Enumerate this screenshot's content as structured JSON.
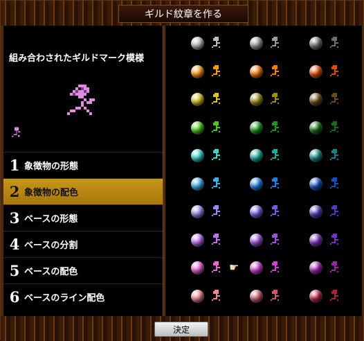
{
  "window": {
    "title": "ギルド紋章を作る"
  },
  "preview": {
    "label": "組み合わされたギルドマーク模様",
    "icon": "rose-mark-icon"
  },
  "menu": {
    "items": [
      {
        "num": "1",
        "label": "象徴物の形態",
        "selected": false
      },
      {
        "num": "2",
        "label": "象徴物の配色",
        "selected": true
      },
      {
        "num": "3",
        "label": "ベースの形態",
        "selected": false
      },
      {
        "num": "4",
        "label": "ベースの分割",
        "selected": false
      },
      {
        "num": "5",
        "label": "ベースの配色",
        "selected": false
      },
      {
        "num": "6",
        "label": "ベースのライン配色",
        "selected": false
      }
    ]
  },
  "palette": {
    "rows": [
      [
        "#bcbcbc",
        "#9a9a9a",
        "#6e6e6e"
      ],
      [
        "#ff9a10",
        "#ff7a00",
        "#e24a00"
      ],
      [
        "#d8c61e",
        "#9e8e10",
        "#6a4a10"
      ],
      [
        "#4acc1a",
        "#1a9a1a",
        "#107010"
      ],
      [
        "#3ad8c8",
        "#1ab0a0",
        "#108888"
      ],
      [
        "#3ab0f0",
        "#1a80e8",
        "#1050c8"
      ],
      [
        "#9a8af0",
        "#7060e0",
        "#5038c0"
      ],
      [
        "#c070f0",
        "#a050e0",
        "#7830c0"
      ],
      [
        "#f060d8",
        "#d040d8",
        "#a020b0"
      ],
      [
        "#f08890",
        "#d05868",
        "#b02040"
      ]
    ],
    "selected_row": 8,
    "selected_col": 1,
    "pointer_icon": "pointing-hand-icon"
  },
  "footer": {
    "confirm_label": "決定"
  },
  "colors": {
    "accent": "#b8860b",
    "frame": "#4a2a10",
    "mark": "#e28ae0"
  }
}
